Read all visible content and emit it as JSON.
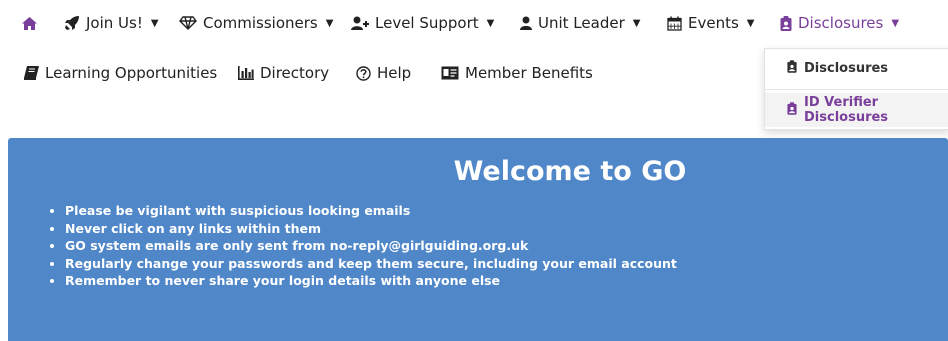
{
  "nav": {
    "row1": {
      "join_label": "Join Us!",
      "commissioners_label": "Commissioners",
      "level_support_label": "Level Support",
      "unit_leader_label": "Unit Leader",
      "events_label": "Events",
      "disclosures_label": "Disclosures"
    },
    "row2": {
      "learning_label": "Learning Opportunities",
      "directory_label": "Directory",
      "help_label": "Help",
      "member_benefits_label": "Member Benefits"
    }
  },
  "dropdown": {
    "items": [
      {
        "label": "Disclosures"
      },
      {
        "label": "ID Verifier Disclosures"
      }
    ]
  },
  "banner": {
    "title": "Welcome to GO",
    "bullets": [
      "Please be vigilant with suspicious looking emails",
      "Never click on any links within them",
      "GO system emails are only sent from no-reply@girlguiding.org.uk",
      "Regularly change your passwords and keep them secure, including your email account",
      "Remember to never share your login details with anyone else"
    ]
  },
  "colors": {
    "accent_purple": "#7a3f9a",
    "banner_blue": "#4f87c8",
    "text_dark": "#222222"
  },
  "icons": {
    "home": "home-icon",
    "join": "rocket-icon",
    "commissioners": "diamond-icon",
    "level_support": "user-plus-icon",
    "unit_leader": "user-icon",
    "events": "calendar-icon",
    "disclosures": "id-badge-icon",
    "learning": "book-icon",
    "directory": "bar-chart-icon",
    "help": "question-circle-icon",
    "member_benefits": "id-card-icon"
  }
}
